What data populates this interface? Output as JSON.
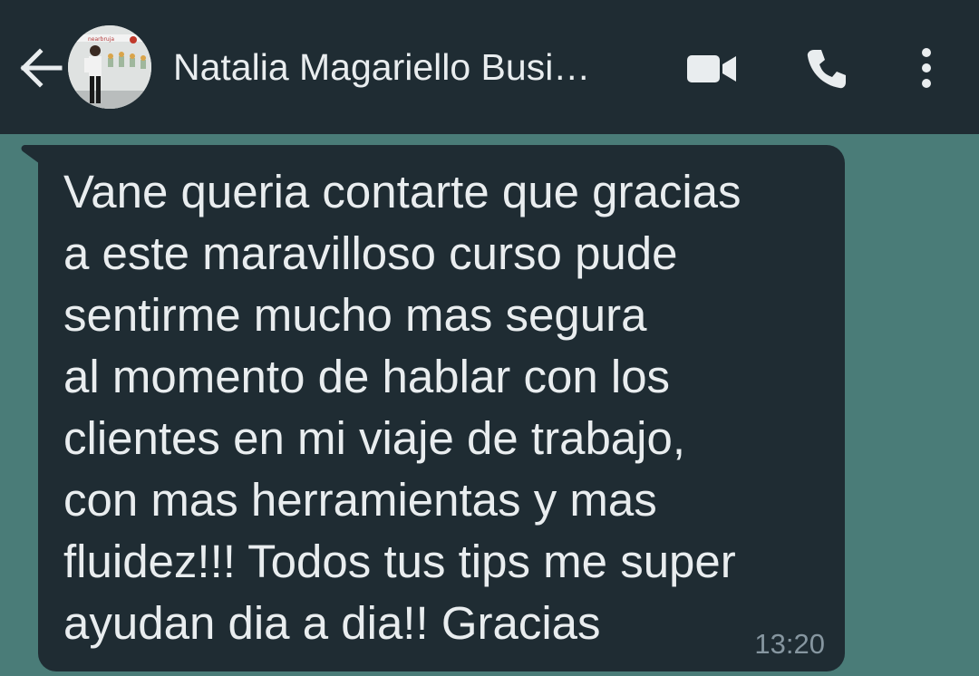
{
  "header": {
    "contact_name": "Natalia Magariello Busi…",
    "back_icon": "arrow-left-icon",
    "video_icon": "video-camera-icon",
    "call_icon": "phone-icon",
    "menu_icon": "more-vert-icon",
    "avatar_banner_text": "nearbruja"
  },
  "message": {
    "lines": [
      "Vane queria contarte que gracias",
      "a este maravilloso curso pude",
      "sentirme mucho mas segura",
      "al momento de hablar con los",
      "clientes en mi viaje de trabajo,",
      "con mas herramientas y mas",
      "fluidez!!! Todos tus tips me super",
      "ayudan dia a dia!! Gracias"
    ],
    "time": "13:20"
  },
  "colors": {
    "header_bg": "#1f2c33",
    "chat_bg": "#4a7c78",
    "bubble_bg": "#1f2c33",
    "text": "#e9edef",
    "meta_text": "#8696a0"
  }
}
